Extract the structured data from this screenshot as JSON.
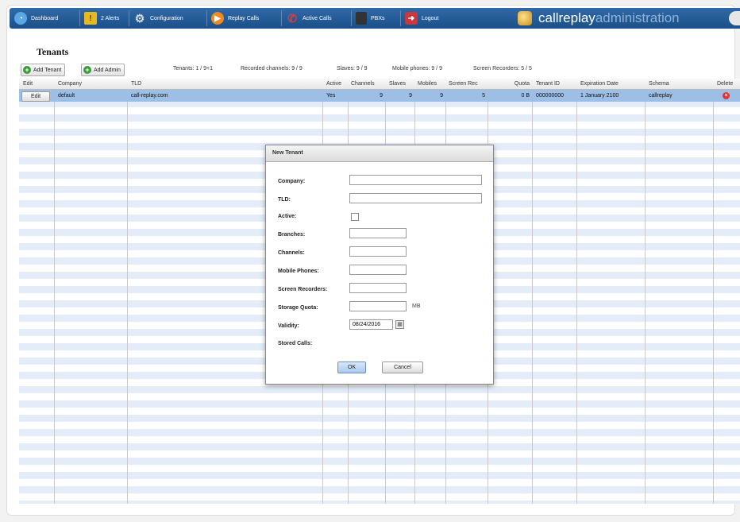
{
  "nav": {
    "items": [
      {
        "label": "Dashboard",
        "icon": "dashboard-icon"
      },
      {
        "label": "2 Alerts",
        "icon": "alert-icon"
      },
      {
        "label": "Configuration",
        "icon": "gear-icon"
      },
      {
        "label": "Replay Calls",
        "icon": "play-icon"
      },
      {
        "label": "Active Calls",
        "icon": "phone-icon"
      },
      {
        "label": "PBXs",
        "icon": "pbx-icon"
      },
      {
        "label": "Logout",
        "icon": "logout-icon"
      }
    ],
    "brand_main": "callreplay",
    "brand_sub": "administration"
  },
  "page": {
    "title": "Tenants",
    "add_tenant": "Add Tenant",
    "add_admin": "Add Admin",
    "stats": {
      "tenants": "Tenants: 1 / 9+1",
      "recorded_channels": "Recorded channels: 9 / 9",
      "slaves": "Slaves: 9 / 9",
      "mobile_phones": "Mobile phones: 9 / 9",
      "screen_recorders": "Screen Recorders: 5 / 5"
    }
  },
  "table": {
    "columns": [
      "Edit",
      "Company",
      "TLD",
      "Active",
      "Channels",
      "Slaves",
      "Mobiles",
      "Screen Rec",
      "Quota",
      "Tenant ID",
      "Expiration Date",
      "Schema",
      "Delete"
    ],
    "row": {
      "edit": "Edit",
      "company": "default",
      "tld": "call-replay.com",
      "active": "Yes",
      "channels": "9",
      "slaves": "9",
      "mobiles": "9",
      "screen_rec": "5",
      "quota": "0 B",
      "tenant_id": "000000000",
      "expiration": "1 January 2100",
      "schema": "callreplay"
    }
  },
  "dialog": {
    "title": "New Tenant",
    "labels": {
      "company": "Company:",
      "tld": "TLD:",
      "active": "Active:",
      "branches": "Branches:",
      "channels": "Channels:",
      "mobile_phones": "Mobile Phones:",
      "screen_recorders": "Screen Recorders:",
      "storage_quota": "Storage Quota:",
      "validity": "Validity:",
      "stored_calls": "Stored Calls:"
    },
    "quota_unit": "MB",
    "validity_value": "08/24/2016",
    "ok": "OK",
    "cancel": "Cancel"
  }
}
